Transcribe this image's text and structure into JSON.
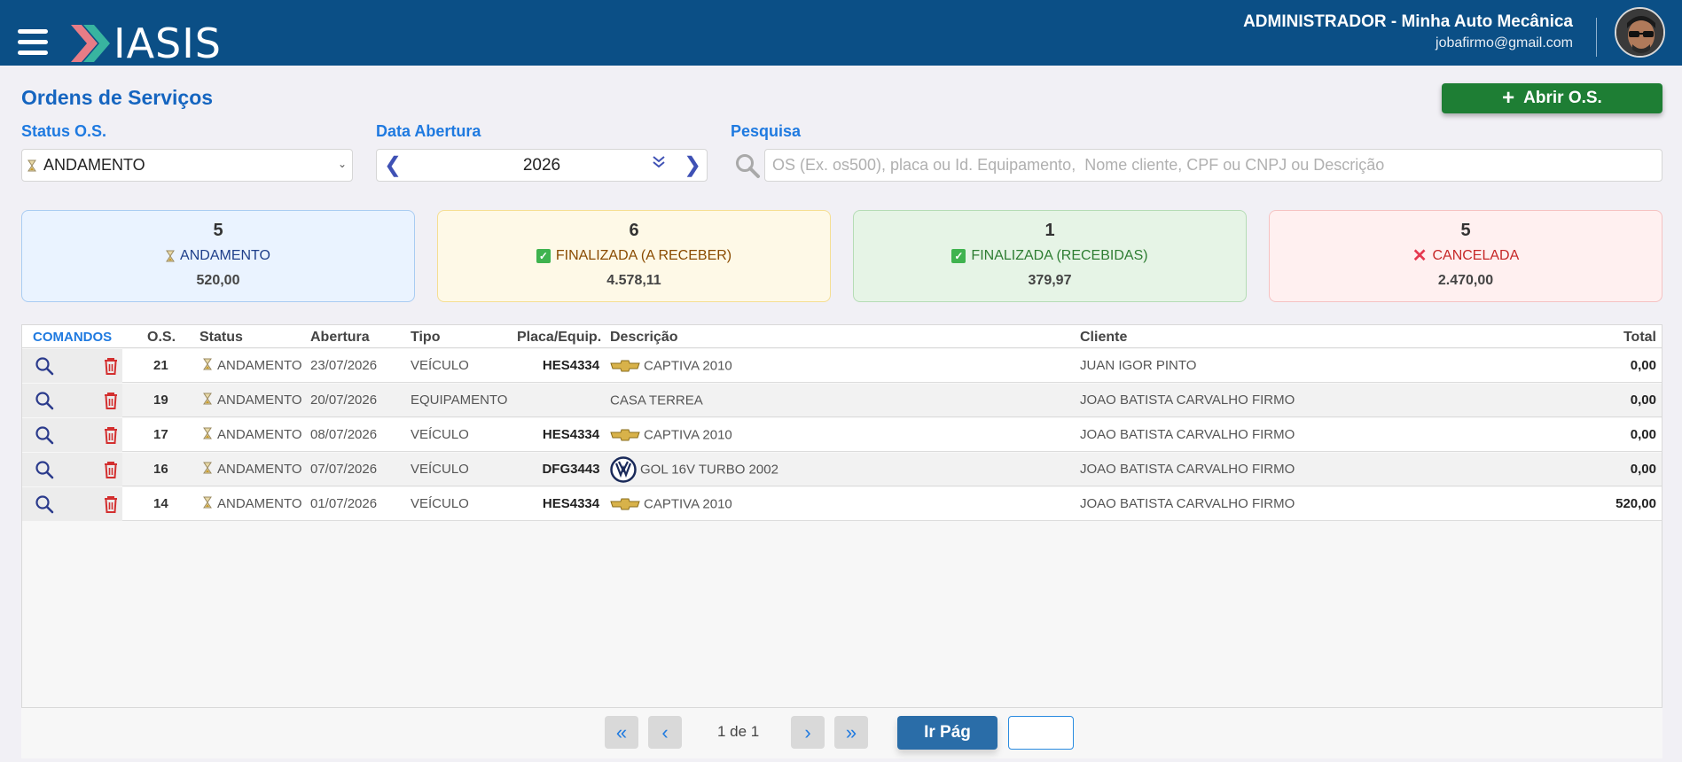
{
  "header": {
    "logo_text": "IASIS",
    "user_name": "ADMINISTRADOR - Minha Auto Mecânica",
    "user_email": "jobafirmo@gmail.com"
  },
  "page": {
    "title": "Ordens de Serviços",
    "open_button_label": "Abrir O.S."
  },
  "filters": {
    "status_label": "Status O.S.",
    "status_value": "ANDAMENTO",
    "date_label": "Data Abertura",
    "date_value": "2026",
    "search_label": "Pesquisa",
    "search_placeholder": "OS (Ex. os500), placa ou Id. Equipamento,  Nome cliente, CPF ou CNPJ ou Descrição"
  },
  "summary_cards": [
    {
      "count": "5",
      "label": "ANDAMENTO",
      "amount": "520,00",
      "icon": "hourglass-icon"
    },
    {
      "count": "6",
      "label": "FINALIZADA (A RECEBER)",
      "amount": "4.578,11",
      "icon": "check-icon"
    },
    {
      "count": "1",
      "label": "FINALIZADA (RECEBIDAS)",
      "amount": "379,97",
      "icon": "check-icon"
    },
    {
      "count": "5",
      "label": "CANCELADA",
      "amount": "2.470,00",
      "icon": "x-icon"
    }
  ],
  "table": {
    "headers": {
      "commands": "COMANDOS",
      "os": "O.S.",
      "status": "Status",
      "opening": "Abertura",
      "type": "Tipo",
      "plate": "Placa/Equip.",
      "description": "Descrição",
      "client": "Cliente",
      "total": "Total"
    },
    "rows": [
      {
        "os": "21",
        "status": "ANDAMENTO",
        "opening": "23/07/2026",
        "type": "VEÍCULO",
        "plate": "HES4334",
        "brand": "chevrolet",
        "description": "CAPTIVA 2010",
        "client": "JUAN IGOR PINTO",
        "total": "0,00"
      },
      {
        "os": "19",
        "status": "ANDAMENTO",
        "opening": "20/07/2026",
        "type": "EQUIPAMENTO",
        "plate": "",
        "brand": "",
        "description": "CASA TERREA",
        "client": "JOAO BATISTA CARVALHO FIRMO",
        "total": "0,00"
      },
      {
        "os": "17",
        "status": "ANDAMENTO",
        "opening": "08/07/2026",
        "type": "VEÍCULO",
        "plate": "HES4334",
        "brand": "chevrolet",
        "description": "CAPTIVA 2010",
        "client": "JOAO BATISTA CARVALHO FIRMO",
        "total": "0,00"
      },
      {
        "os": "16",
        "status": "ANDAMENTO",
        "opening": "07/07/2026",
        "type": "VEÍCULO",
        "plate": "DFG3443",
        "brand": "volkswagen",
        "description": "GOL 16V TURBO 2002",
        "client": "JOAO BATISTA CARVALHO FIRMO",
        "total": "0,00"
      },
      {
        "os": "14",
        "status": "ANDAMENTO",
        "opening": "01/07/2026",
        "type": "VEÍCULO",
        "plate": "HES4334",
        "brand": "chevrolet",
        "description": "CAPTIVA 2010",
        "client": "JOAO BATISTA CARVALHO FIRMO",
        "total": "520,00"
      }
    ]
  },
  "pagination": {
    "page_info": "1 de 1",
    "go_label": "Ir Pág"
  },
  "colors": {
    "header_bg": "#0b4f86",
    "accent_blue": "#1f7ae0",
    "primary_green": "#1e7e34",
    "danger_red": "#d32f2f"
  }
}
